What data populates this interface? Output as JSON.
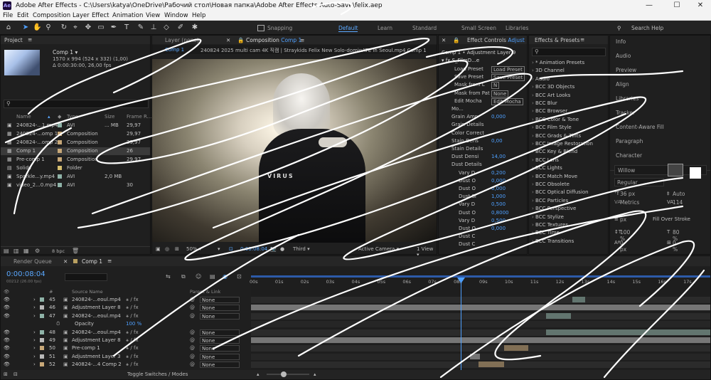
{
  "app": {
    "title": "Adobe After Effects - C:\\Users\\katya\\OneDrive\\Рабочий стол\\Новая папка\\Adobe After Effects Auto-Save\\felix.aep",
    "icon": "Ae"
  },
  "menu": [
    "File",
    "Edit",
    "Composition",
    "Layer",
    "Effect",
    "Animation",
    "View",
    "Window",
    "Help"
  ],
  "toolbar": {
    "snapping": "Snapping",
    "workspaces": [
      "Default",
      "Learn",
      "Standard",
      "Small Screen",
      "Libraries"
    ],
    "search": "Search Help"
  },
  "project": {
    "tab": "Project",
    "comp_name": "Comp 1",
    "comp_dims": "1570 x 994  (524 x 332) (1,00)",
    "comp_dur": "Δ 0:00:30:00, 26,00 fps",
    "search_placeholder": "",
    "cols": {
      "name": "Name",
      "type": "Type",
      "size": "Size",
      "fps": "Frame R..."
    },
    "items": [
      {
        "name": "240824-...1.mp4",
        "type": "AVI",
        "size": "... MB",
        "fps": "29,97"
      },
      {
        "name": "240824-...omp 1",
        "type": "Composition",
        "size": "",
        "fps": "29,97"
      },
      {
        "name": "240824-...omp 2",
        "type": "Composition",
        "size": "",
        "fps": "29,97"
      },
      {
        "name": "Comp 1",
        "type": "Composition",
        "size": "",
        "fps": "26"
      },
      {
        "name": "Pre-comp 1",
        "type": "Composition",
        "size": "",
        "fps": "29,97"
      },
      {
        "name": "Solids",
        "type": "Folder",
        "size": "",
        "fps": ""
      },
      {
        "name": "Sparkle...y.mp4",
        "type": "AVI",
        "size": "2,0 MB",
        "fps": ""
      },
      {
        "name": "video_2...0.mp4",
        "type": "AVI",
        "size": "",
        "fps": "30"
      }
    ],
    "bpc": "8 bpc"
  },
  "viewer": {
    "layer_tab": "Layer  (none)",
    "comp_tab": "Composition",
    "comp_tab_name": "Comp 1",
    "breadcrumb_comp": "Comp 1",
    "breadcrumb_file": "240824 2025 multi cam 4K 직캠 | Straykids Felix New Solo-dominATE in Seoul.mp4 Comp 1",
    "overlay_text": "VIRUS",
    "zoom": "50%",
    "timecode": "0:00:08:04",
    "view": "Third",
    "camera": "Active Camera",
    "views": "1 View"
  },
  "effect_controls": {
    "tab": "Effect Controls",
    "tab_name": "Adjust",
    "layer": "Comp 1 • Adjustment Layer 9",
    "fx": "S_FilmD...e",
    "rows": [
      {
        "label": "Load Preset",
        "value": "Load Preset"
      },
      {
        "label": "Save Preset",
        "value": "Save Preset"
      },
      {
        "label": "Mask from L",
        "value": "N"
      },
      {
        "label": "Mask from Pat",
        "value": "None"
      },
      {
        "label": "Edit Mocha",
        "value": "Edit Mocha"
      },
      {
        "label": "Mo...",
        "value": ""
      },
      {
        "label": "Grain Amp",
        "value": "0,000"
      },
      {
        "label": "Grain Details",
        "value": ""
      },
      {
        "label": "Color Correct",
        "value": ""
      },
      {
        "label": "Stain Dens",
        "value": "0,00"
      },
      {
        "label": "Stain Details",
        "value": ""
      },
      {
        "label": "Dust Densi",
        "value": "14,00"
      },
      {
        "label": "Dust Details",
        "value": ""
      },
      {
        "label": "Vary D",
        "value": "0,200"
      },
      {
        "label": "Dust O",
        "value": "0,000"
      },
      {
        "label": "Dust O",
        "value": "0,000"
      },
      {
        "label": "Dust Si",
        "value": "1,000"
      },
      {
        "label": "Vary D",
        "value": "0,500"
      },
      {
        "label": "Dust O",
        "value": "0,8000"
      },
      {
        "label": "Vary D",
        "value": "0,500"
      },
      {
        "label": "Dust O",
        "value": "0,000"
      },
      {
        "label": "Dust C",
        "value": ""
      },
      {
        "label": "Dust C",
        "value": ""
      }
    ]
  },
  "effects_presets": {
    "tab": "Effects & Presets",
    "items": [
      "* Animation Presets",
      "3D Channel",
      "Audio",
      "BCC 3D Objects",
      "BCC Art Looks",
      "BCC Blur",
      "BCC Browser",
      "BCC Color & Tone",
      "BCC Film Style",
      "BCC Grads & Tints",
      "BCC Image Restoration",
      "BCC Key & Blend",
      "BCC Lens",
      "BCC Lights",
      "BCC Match Move",
      "BCC Obsolete",
      "BCC Optical Diffusion",
      "BCC Particles",
      "BCC Perspective",
      "BCC Stylize",
      "BCC Textures",
      "BCC Time",
      "BCC Transitions"
    ]
  },
  "right_panels": [
    "Info",
    "Audio",
    "Preview",
    "Align",
    "Libraries",
    "Tracker",
    "Content-Aware Fill",
    "Paragraph",
    "Character"
  ],
  "character": {
    "font": "Willow",
    "style": "Regular",
    "size": "36 px",
    "leading": "Auto",
    "tracking": "114",
    "metrics": "Metrics",
    "stroke": "px",
    "stroke_mode": "Fill Over Stroke",
    "vscale": "100 %",
    "hscale": "80 %",
    "baseline": "0 px",
    "tsume": "0 %"
  },
  "timeline": {
    "tabs": [
      "Render Queue",
      "Comp 1"
    ],
    "time": "0:00:08:04",
    "frames": "00212 (26.00 fps)",
    "source_col": "Source Name",
    "parent_col": "Parent & Link",
    "ruler": [
      "00s",
      "01s",
      "02s",
      "03s",
      "04s",
      "05s",
      "06s",
      "07s",
      "08s",
      "09s",
      "10s",
      "11s",
      "12s",
      "13s",
      "14s",
      "15s",
      "16s",
      "17s"
    ],
    "layers": [
      {
        "num": "45",
        "name": "240824-...eoul.mp4",
        "parent": "None",
        "color": "#8fb3a8"
      },
      {
        "num": "46",
        "name": "Adjustment Layer 8",
        "parent": "None",
        "color": "#b8b8b8"
      },
      {
        "num": "47",
        "name": "240824-...eoul.mp4",
        "parent": "None",
        "color": "#8fb3a8"
      },
      {
        "num": "",
        "name": "Opacity",
        "parent": "100 %",
        "color": ""
      },
      {
        "num": "48",
        "name": "240824-...eoul.mp4",
        "parent": "None",
        "color": "#8fb3a8"
      },
      {
        "num": "49",
        "name": "Adjustment Layer 8",
        "parent": "None",
        "color": "#b8b8b8"
      },
      {
        "num": "50",
        "name": "Pre-comp 1",
        "parent": "None",
        "color": "#c8a878"
      },
      {
        "num": "51",
        "name": "Adjustment Layer 3",
        "parent": "None",
        "color": "#b8b8b8"
      },
      {
        "num": "52",
        "name": "240824-...4 Comp 2",
        "parent": "None",
        "color": "#c8a878"
      }
    ],
    "footer": "Toggle Switches / Modes"
  }
}
